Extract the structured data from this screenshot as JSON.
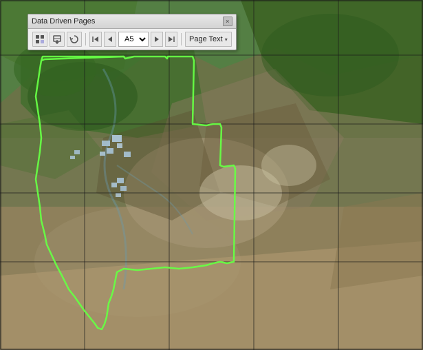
{
  "panel": {
    "title": "Data Driven Pages",
    "close_label": "×",
    "page_value": "A5",
    "page_text_label": "Page Text",
    "page_text_arrow": "▾"
  },
  "toolbar": {
    "btn1_icon": "setup-icon",
    "btn2_icon": "export-icon",
    "btn3_icon": "refresh-icon",
    "nav_first": "◀◀",
    "nav_prev": "◀",
    "nav_next": "▶",
    "nav_last": "▶▶"
  },
  "grid": {
    "cols": 5,
    "rows": 5
  }
}
